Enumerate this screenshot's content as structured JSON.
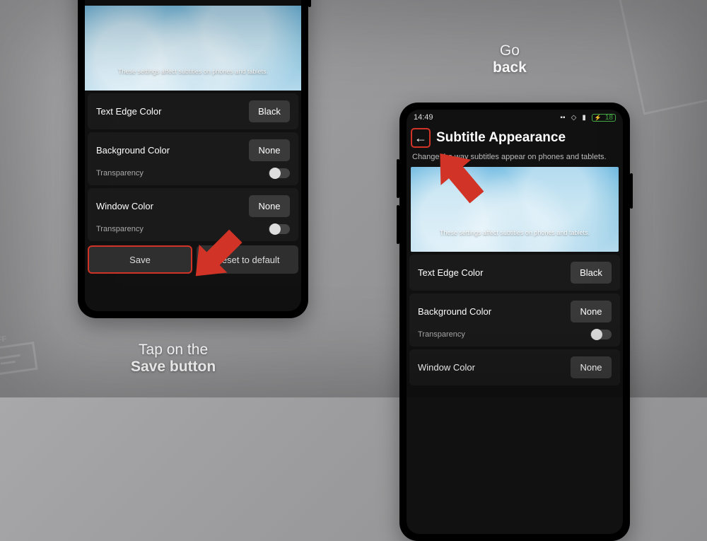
{
  "left_phone": {
    "preview_text": "These settings affect subtitles on phones and tablets.",
    "rows": {
      "text_edge_color": {
        "label": "Text Edge Color",
        "value": "Black"
      },
      "background_color": {
        "label": "Background Color",
        "value": "None",
        "transparency_label": "Transparency"
      },
      "window_color": {
        "label": "Window Color",
        "value": "None",
        "transparency_label": "Transparency"
      }
    },
    "buttons": {
      "save": "Save",
      "reset": "Reset to default"
    }
  },
  "right_phone": {
    "status": {
      "time": "14:49",
      "battery": "18"
    },
    "title": "Subtitle Appearance",
    "subtitle": "Change the way subtitles appear on phones and tablets.",
    "preview_text": "These settings affect subtitles on phones and tablets.",
    "rows": {
      "text_edge_color": {
        "label": "Text Edge Color",
        "value": "Black"
      },
      "background_color": {
        "label": "Background Color",
        "value": "None",
        "transparency_label": "Transparency"
      },
      "window_color": {
        "label": "Window Color",
        "value": "None"
      }
    }
  },
  "captions": {
    "left_line1": "Tap on the",
    "left_line2": "Save button",
    "right_line1": "Go",
    "right_line2": "back"
  }
}
